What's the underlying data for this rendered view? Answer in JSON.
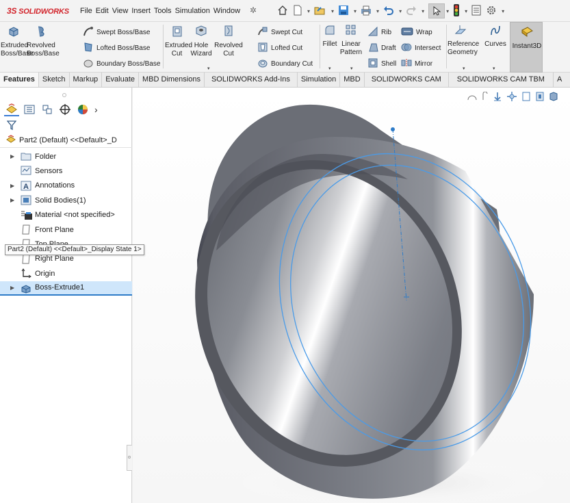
{
  "app": {
    "logo_ds": "3S",
    "logo_text": "SOLIDWORKS"
  },
  "menu": [
    "File",
    "Edit",
    "View",
    "Insert",
    "Tools",
    "Simulation",
    "Window"
  ],
  "quick_access": [
    "home-icon",
    "new-document-icon",
    "open-icon",
    "save-icon",
    "print-icon",
    "undo-icon",
    "redo-icon",
    "select-icon",
    "rebuild-icon",
    "file-properties-icon",
    "options-icon"
  ],
  "ribbon": {
    "extruded_boss": "Extruded\nBoss/Base",
    "revolved_boss": "Revolved\nBoss/Base",
    "swept_boss": "Swept Boss/Base",
    "lofted_boss": "Lofted Boss/Base",
    "boundary_boss": "Boundary Boss/Base",
    "extruded_cut": "Extruded\nCut",
    "hole_wizard": "Hole\nWizard",
    "revolved_cut": "Revolved\nCut",
    "swept_cut": "Swept Cut",
    "lofted_cut": "Lofted Cut",
    "boundary_cut": "Boundary Cut",
    "fillet": "Fillet",
    "linear_pattern": "Linear\nPattern",
    "rib": "Rib",
    "draft": "Draft",
    "shell": "Shell",
    "wrap": "Wrap",
    "intersect": "Intersect",
    "mirror": "Mirror",
    "reference_geometry": "Reference\nGeometry",
    "curves": "Curves",
    "instant3d": "Instant3D"
  },
  "tabs": [
    "Features",
    "Sketch",
    "Markup",
    "Evaluate",
    "MBD Dimensions",
    "SOLIDWORKS Add-Ins",
    "Simulation",
    "MBD",
    "SOLIDWORKS CAM",
    "SOLIDWORKS CAM TBM",
    "A"
  ],
  "active_tab": "Features",
  "feature_tree": {
    "root_label": "Part2 (Default) <<Default>_D",
    "tooltip": "Part2 (Default) <<Default>_Display State 1>",
    "items": [
      {
        "label": "Folder",
        "icon": "folder-icon",
        "expandable": true
      },
      {
        "label": "Sensors",
        "icon": "sensors-icon",
        "expandable": false
      },
      {
        "label": "Annotations",
        "icon": "annotations-icon",
        "expandable": true
      },
      {
        "label": "Solid Bodies(1)",
        "icon": "solid-bodies-icon",
        "expandable": true
      },
      {
        "label": "Material <not specified>",
        "icon": "material-icon",
        "expandable": false
      },
      {
        "label": "Front Plane",
        "icon": "plane-icon",
        "expandable": false
      },
      {
        "label": "Top Plane",
        "icon": "plane-icon",
        "expandable": false
      },
      {
        "label": "Right Plane",
        "icon": "plane-icon",
        "expandable": false
      },
      {
        "label": "Origin",
        "icon": "origin-icon",
        "expandable": false
      },
      {
        "label": "Boss-Extrude1",
        "icon": "boss-extrude-icon",
        "expandable": true,
        "selected": true
      }
    ]
  },
  "colors": {
    "accent": "#2d7bc8",
    "selection_highlight": "#4a9be8",
    "model_gray": "#7d8088",
    "logo_red": "#d2232a"
  }
}
